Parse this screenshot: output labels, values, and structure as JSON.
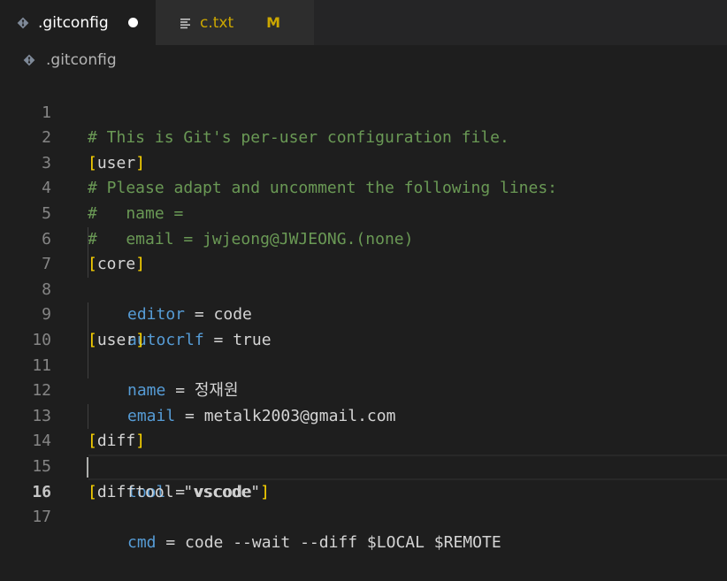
{
  "tabs": [
    {
      "label": ".gitconfig",
      "icon": "git-icon",
      "modified": true
    },
    {
      "label": "c.txt",
      "icon": "text-file-icon",
      "status": "M"
    }
  ],
  "breadcrumb": {
    "file": ".gitconfig",
    "icon": "git-icon"
  },
  "editor": {
    "current_line": 16,
    "line_numbers": [
      "1",
      "2",
      "3",
      "4",
      "5",
      "6",
      "7",
      "8",
      "9",
      "10",
      "11",
      "12",
      "13",
      "14",
      "15",
      "16",
      "17"
    ],
    "l1": {
      "comment": "# This is Git's per-user configuration file."
    },
    "l2": {
      "section": "user"
    },
    "l3": {
      "comment": "# Please adapt and uncomment the following lines:"
    },
    "l4": {
      "comment": "#   name ="
    },
    "l5": {
      "comment": "#   email = jwjeong@JWJEONG.(none)"
    },
    "l6": {
      "section": "core"
    },
    "l7": {
      "key": "editor",
      "eq": " = ",
      "value": "code"
    },
    "l8": {
      "key": "autocrlf",
      "eq": " = ",
      "value": "true"
    },
    "l9": {
      "section": "user"
    },
    "l10": {
      "key": "name",
      "eq": " = ",
      "value": "정재원"
    },
    "l11": {
      "key": "email",
      "eq": " = ",
      "value": "metalk2003@gmail.com"
    },
    "l13": {
      "section": "diff"
    },
    "l14": {
      "key": "tool",
      "eq": " = ",
      "value": "vscode"
    },
    "l15": {
      "section": "difftool \"vscode\""
    },
    "l16": {
      "key": "cmd",
      "eq": " = ",
      "value": "code --wait --diff $LOCAL $REMOTE"
    }
  },
  "colors": {
    "background": "#1e1e1e",
    "comment": "#6a9955",
    "bracket": "#ffd700",
    "key": "#569cd6",
    "modified": "#cca700"
  }
}
